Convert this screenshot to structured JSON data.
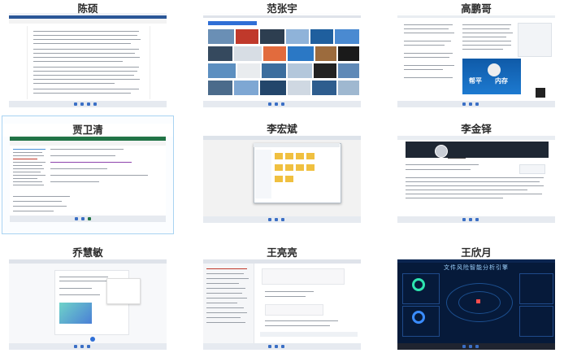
{
  "participants": [
    {
      "name": "陈硕",
      "screen": "word-document"
    },
    {
      "name": "范张宇",
      "screen": "image-search"
    },
    {
      "name": "高鹏哥",
      "screen": "web-article"
    },
    {
      "name": "贾卫清",
      "screen": "spreadsheet",
      "selected": true
    },
    {
      "name": "李宏斌",
      "screen": "file-dialog"
    },
    {
      "name": "李金铎",
      "screen": "profile-page"
    },
    {
      "name": "乔慧敏",
      "screen": "browser-page"
    },
    {
      "name": "王亮亮",
      "screen": "code-browser"
    },
    {
      "name": "王欣月",
      "screen": "dashboard"
    }
  ],
  "dashboard_title": "文件风险智能分析引擎",
  "web_article_badges": [
    "帮平",
    "内存"
  ]
}
